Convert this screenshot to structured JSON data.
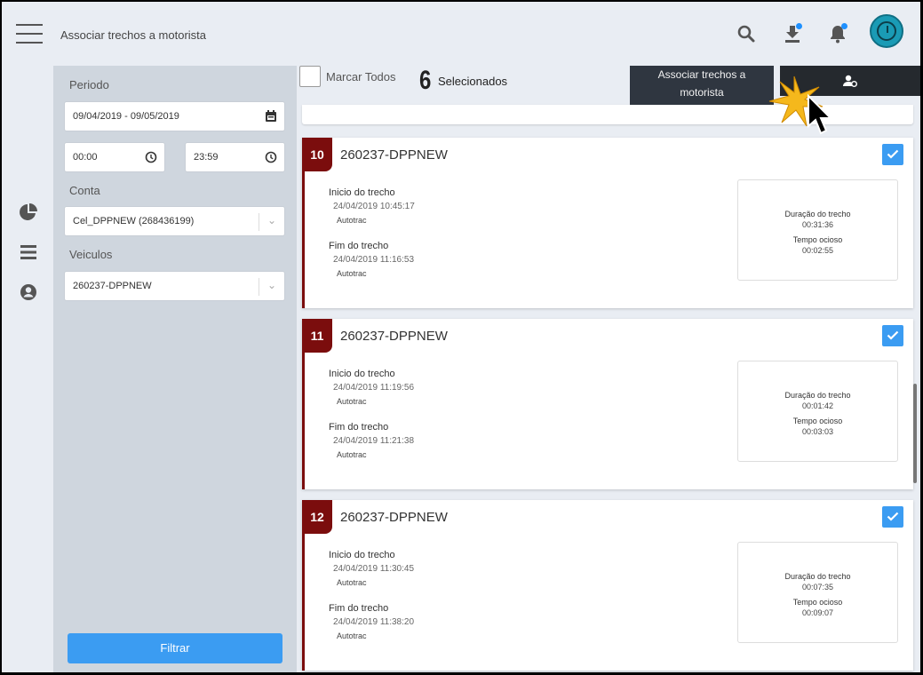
{
  "header": {
    "title": "Associar trechos a motorista"
  },
  "filter": {
    "period_label": "Periodo",
    "period_value": "09/04/2019 - 09/05/2019",
    "time_start": "00:00",
    "time_end": "23:59",
    "account_label": "Conta",
    "account_value": "Cel_DPPNEW (268436199)",
    "vehicles_label": "Veiculos",
    "vehicle_value": "260237-DPPNEW",
    "filter_button": "Filtrar"
  },
  "toolbar": {
    "mark_all": "Marcar Todos",
    "selected_count": "6",
    "selected_label": "Selecionados",
    "associate_button": "Associar trechos a motorista"
  },
  "cards": [
    {
      "number": "10",
      "title": "260237-DPPNEW",
      "start_label": "Inicio do trecho",
      "start_time": "24/04/2019 10:45:17",
      "start_source": "Autotrac",
      "end_label": "Fim do trecho",
      "end_time": "24/04/2019 11:16:53",
      "end_source": "Autotrac",
      "duration_label": "Duração do trecho",
      "duration_value": "00:31:36",
      "idle_label": "Tempo ocioso",
      "idle_value": "00:02:55"
    },
    {
      "number": "11",
      "title": "260237-DPPNEW",
      "start_label": "Inicio do trecho",
      "start_time": "24/04/2019 11:19:56",
      "start_source": "Autotrac",
      "end_label": "Fim do trecho",
      "end_time": "24/04/2019 11:21:38",
      "end_source": "Autotrac",
      "duration_label": "Duração do trecho",
      "duration_value": "00:01:42",
      "idle_label": "Tempo ocioso",
      "idle_value": "00:03:03"
    },
    {
      "number": "12",
      "title": "260237-DPPNEW",
      "start_label": "Inicio do trecho",
      "start_time": "24/04/2019 11:30:45",
      "start_source": "Autotrac",
      "end_label": "Fim do trecho",
      "end_time": "24/04/2019 11:38:20",
      "end_source": "Autotrac",
      "duration_label": "Duração do trecho",
      "duration_value": "00:07:35",
      "idle_label": "Tempo ocioso",
      "idle_value": "00:09:07"
    }
  ],
  "icons": {
    "menu": "hamburger-menu-icon",
    "search": "search-icon",
    "download": "download-icon",
    "bell": "bell-icon",
    "user_driver": "user-driver-icon",
    "chart": "pie-chart-icon",
    "list": "list-icon",
    "account": "account-circle-icon"
  },
  "colors": {
    "accent": "#3b9cf2",
    "badge": "#7b0d0d",
    "dark_button": "#2f3640",
    "notification_dot": "#1e90ff",
    "avatar": "#1a9bb5"
  }
}
